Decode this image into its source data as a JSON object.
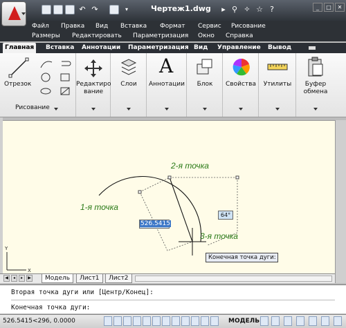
{
  "window": {
    "title": "Чертеж1.dwg"
  },
  "menu": [
    "Файл",
    "Правка",
    "Вид",
    "Вставка",
    "Формат",
    "Сервис",
    "Рисование",
    "Размеры",
    "Редактировать",
    "Параметризация",
    "Окно",
    "Справка"
  ],
  "ribbon_tabs": [
    "Главная",
    "Вставка",
    "Аннотации",
    "Параметризация",
    "Вид",
    "Управление",
    "Вывод"
  ],
  "ribbon": {
    "line": "Отрезок",
    "edit_1": "Редактиро",
    "edit_2": "вание",
    "layers": "Слои",
    "annotations": "Аннотации",
    "block": "Блок",
    "properties": "Свойства",
    "utilities": "Утилиты",
    "clipboard_1": "Буфер",
    "clipboard_2": "обмена",
    "draw_group": "Рисование"
  },
  "canvas": {
    "point1": "1-я точка",
    "point2": "2-я точка",
    "point3": "3-я точка",
    "dyn_input": "526.5415",
    "angle": "64°",
    "tooltip": "Конечная точка дуги:"
  },
  "layout_tabs": [
    "Модель",
    "Лист1",
    "Лист2"
  ],
  "command": {
    "line1": "Вторая точка дуги или [Центр/Конец]:",
    "line2": "Конечная точка дуги:"
  },
  "status": {
    "coords": "526.5415<296, 0.0000",
    "model": "МОДЕЛЬ"
  },
  "colors": {
    "canvas_bg": "#fffce8",
    "annotation": "#2a7a17",
    "title_bg": "#2f343a"
  }
}
